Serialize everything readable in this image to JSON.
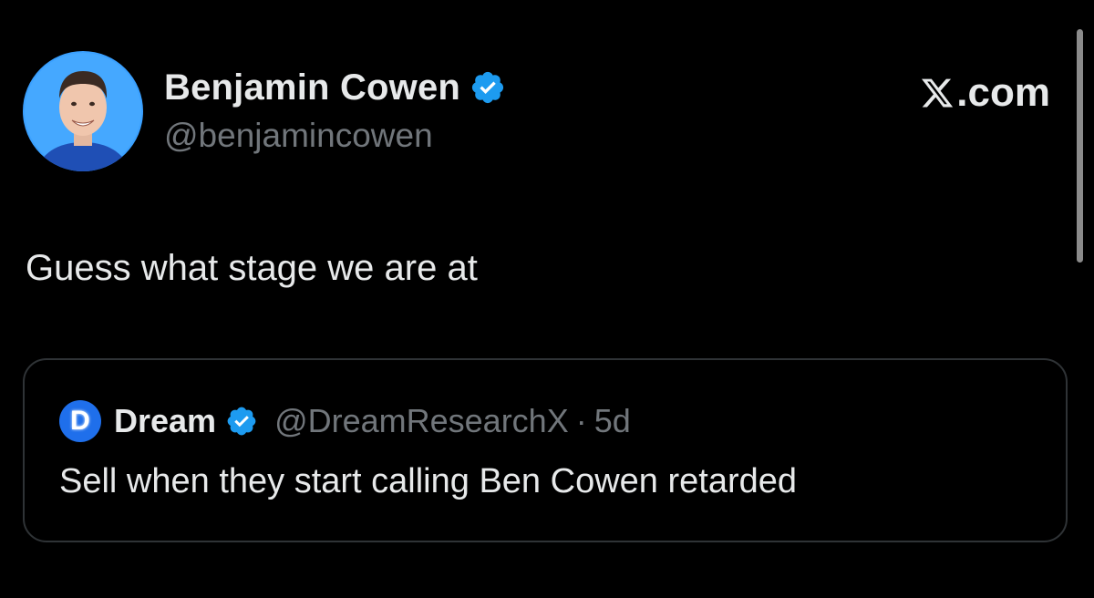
{
  "author": {
    "display_name": "Benjamin Cowen",
    "handle": "@benjamincowen",
    "verified": true,
    "verified_badge_icon": "verified-badge-icon",
    "avatar_icon": "profile-photo"
  },
  "brand": {
    "logo_icon": "x-logo-icon",
    "suffix": ".com"
  },
  "tweet": {
    "text": "Guess what stage we are at"
  },
  "quoted_tweet": {
    "avatar_letter": "D",
    "display_name": "Dream",
    "verified": true,
    "handle": "@DreamResearchX",
    "separator": "·",
    "time": "5d",
    "text": "Sell when they start calling Ben Cowen retarded"
  },
  "colors": {
    "background": "#000000",
    "primary_text": "#e7e9ea",
    "secondary_text": "#71767b",
    "verified_blue": "#1d9bf0",
    "card_border": "#2f3336",
    "avatar_bg": "#3aa0ff"
  }
}
